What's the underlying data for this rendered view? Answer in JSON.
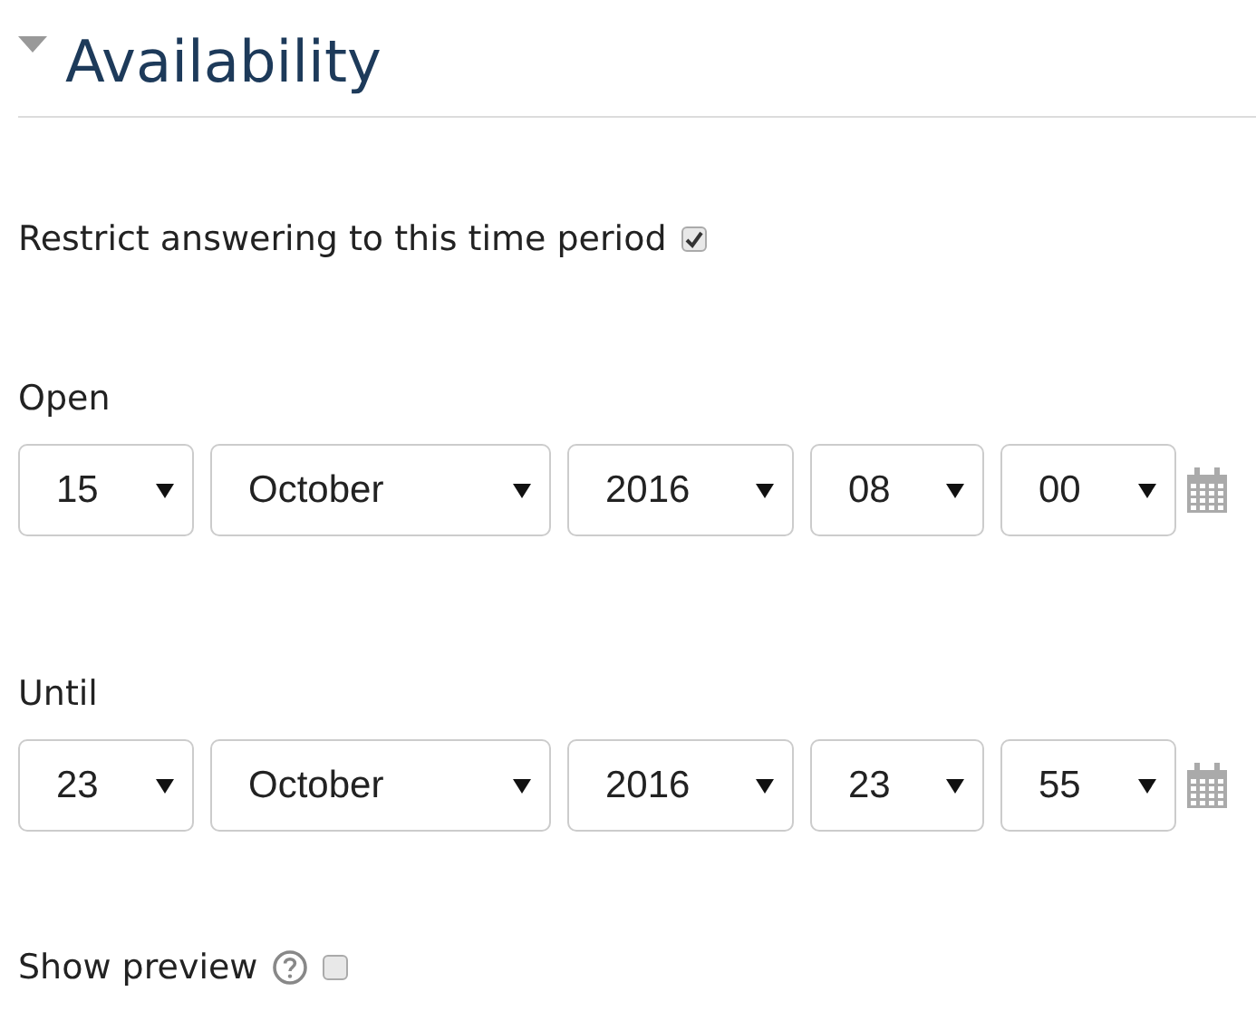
{
  "section": {
    "title": "Availability",
    "expanded": true
  },
  "restrict": {
    "label": "Restrict answering to this time period",
    "checked": true
  },
  "date_groups": [
    {
      "label": "Open",
      "fields": [
        {
          "value": "15",
          "kind": "day"
        },
        {
          "value": "October",
          "kind": "month"
        },
        {
          "value": "2016",
          "kind": "year"
        },
        {
          "value": "08",
          "kind": "hour"
        },
        {
          "value": "00",
          "kind": "minute"
        }
      ]
    },
    {
      "label": "Until",
      "fields": [
        {
          "value": "23",
          "kind": "day"
        },
        {
          "value": "October",
          "kind": "month"
        },
        {
          "value": "2016",
          "kind": "year"
        },
        {
          "value": "23",
          "kind": "hour"
        },
        {
          "value": "55",
          "kind": "minute"
        }
      ]
    }
  ],
  "preview": {
    "label": "Show preview",
    "checked": false
  }
}
